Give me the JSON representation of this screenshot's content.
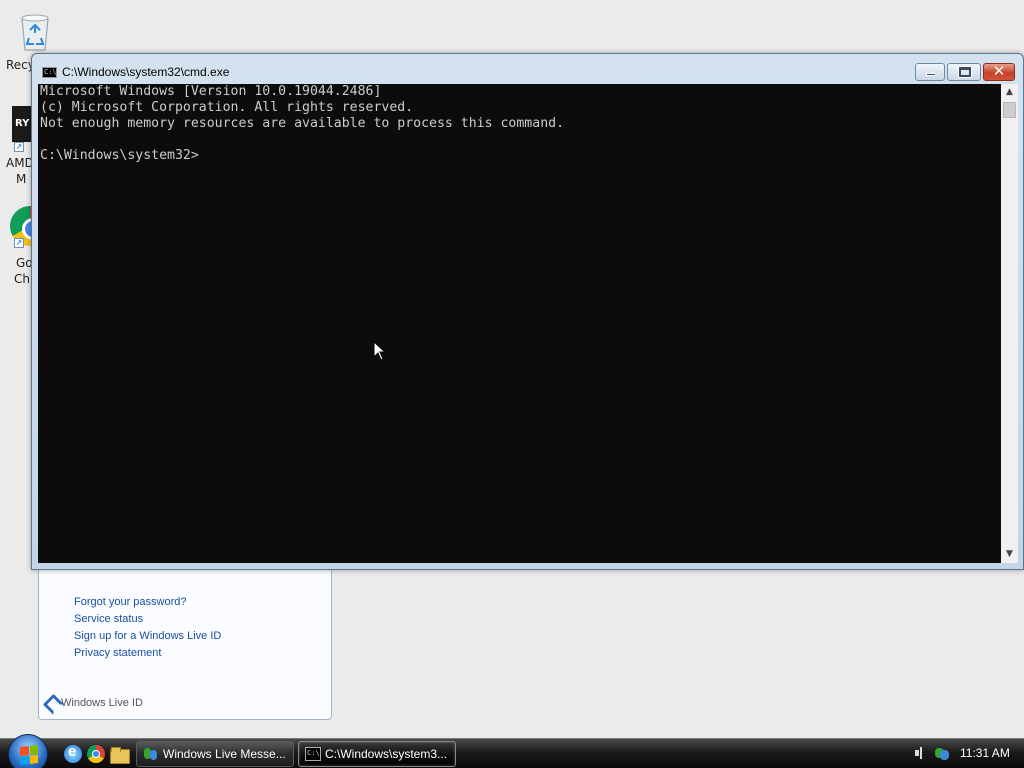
{
  "desktop": {
    "icons": [
      {
        "name": "recycle-bin",
        "label_lines": [
          "Recy"
        ]
      },
      {
        "name": "amd-shortcut",
        "label_lines": [
          "AMD",
          "M"
        ],
        "badge": "RY"
      },
      {
        "name": "google-chrome-shortcut",
        "label_lines": [
          "Go",
          "Chr"
        ]
      }
    ]
  },
  "cmd_window": {
    "title": "C:\\Windows\\system32\\cmd.exe",
    "icon_text": "C:\\",
    "console_lines": [
      "Microsoft Windows [Version 10.0.19044.2486]",
      "(c) Microsoft Corporation. All rights reserved.",
      "Not enough memory resources are available to process this command.",
      "",
      "C:\\Windows\\system32>"
    ],
    "colors": {
      "console_bg": "#0c0c0c",
      "console_fg": "#cccccc"
    },
    "caption_buttons": [
      "minimize-icon",
      "maximize-icon",
      "close-icon"
    ]
  },
  "windows_live_panel": {
    "links": {
      "forgot_password": "Forgot your password?",
      "service_status": "Service status",
      "sign_up": "Sign up for a Windows Live ID",
      "privacy": "Privacy statement"
    },
    "footer": "Windows Live ID"
  },
  "taskbar": {
    "quick_launch": [
      "internet-explorer-icon",
      "chrome-icon",
      "explorer-folder-icon"
    ],
    "tasks": {
      "messenger": "Windows Live Messe...",
      "cmd": "C:\\Windows\\system3...",
      "cmd_icon_text": "C:\\"
    },
    "tray": {
      "icons": [
        "speaker-icon",
        "messenger-status-icon"
      ],
      "time": "11:31 AM"
    }
  }
}
